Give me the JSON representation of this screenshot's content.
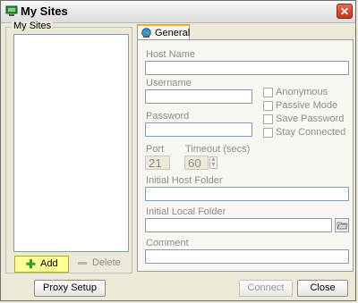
{
  "window": {
    "title": "My Sites"
  },
  "sites_panel": {
    "group_label": "My Sites",
    "add_label": "Add",
    "delete_label": "Delete"
  },
  "tabs": [
    {
      "label": "General",
      "active": true
    }
  ],
  "form": {
    "host_name": {
      "label": "Host Name",
      "value": ""
    },
    "username": {
      "label": "Username",
      "value": ""
    },
    "password": {
      "label": "Password",
      "value": ""
    },
    "port": {
      "label": "Port",
      "value": "21"
    },
    "timeout": {
      "label": "Timeout (secs)",
      "value": "60"
    },
    "initial_host_folder": {
      "label": "Initial Host Folder",
      "value": ""
    },
    "initial_local_folder": {
      "label": "Initial Local Folder",
      "value": ""
    },
    "comment": {
      "label": "Comment",
      "value": ""
    },
    "options": [
      {
        "label": "Anonymous",
        "checked": false
      },
      {
        "label": "Passive Mode",
        "checked": false
      },
      {
        "label": "Save Password",
        "checked": false
      },
      {
        "label": "Stay Connected",
        "checked": false
      }
    ]
  },
  "footer": {
    "proxy_label": "Proxy Setup",
    "connect_label": "Connect",
    "close_label": "Close"
  },
  "colors": {
    "add_button_bg": "#ffff99",
    "tab_accent": "#f2a72f",
    "close_icon_bg": "#c1371f"
  },
  "icons": [
    "app-ftp-icon",
    "close-icon",
    "plus-icon",
    "minus-icon",
    "globe-icon",
    "folder-browse-icon"
  ]
}
